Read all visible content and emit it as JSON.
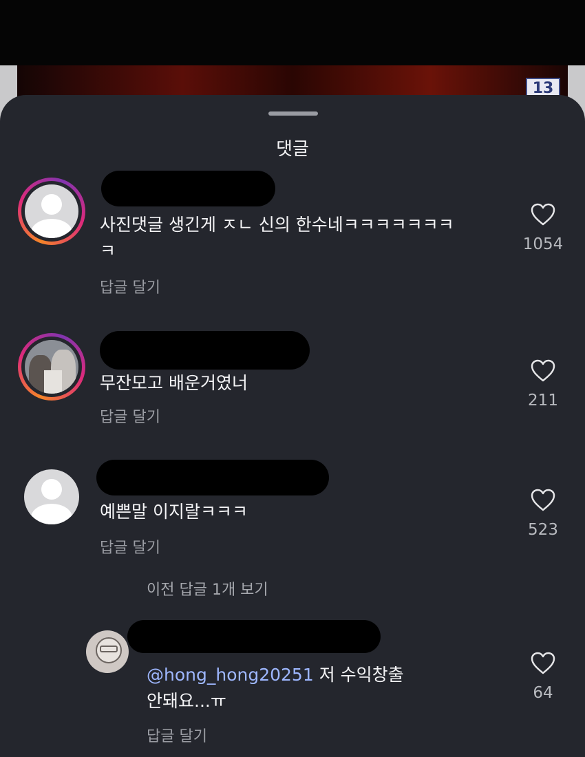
{
  "background": {
    "page_number": "13"
  },
  "sheet": {
    "title": "댓글"
  },
  "comments": [
    {
      "text_line1": "사진댓글 생긴게 ㅈㄴ 신의 한수네ㅋㅋㅋㅋㅋㅋㅋ",
      "text_line2": "ㅋ",
      "reply_label": "답글 달기",
      "likes": "1054"
    },
    {
      "text_line1": "무잔모고 배운거였너",
      "reply_label": "답글 달기",
      "likes": "211"
    },
    {
      "text_line1": "예쁜말 이지랄ㅋㅋㅋ",
      "reply_label": "답글 달기",
      "likes": "523",
      "view_replies_label": "이전 답글 1개 보기"
    }
  ],
  "reply": {
    "mention": "@hong_hong20251",
    "text_after_mention": " 저 수익창출",
    "text_line2": "안돼요...ㅠ",
    "reply_label": "답글 달기",
    "likes": "64"
  },
  "colors": {
    "sheet_bg": "#24262d",
    "mention": "#9eb7ff",
    "story_ring": [
      "#f58529",
      "#dd2a7b",
      "#8134af"
    ]
  },
  "icons": [
    "heart-icon",
    "default-avatar-icon",
    "drag-handle"
  ]
}
